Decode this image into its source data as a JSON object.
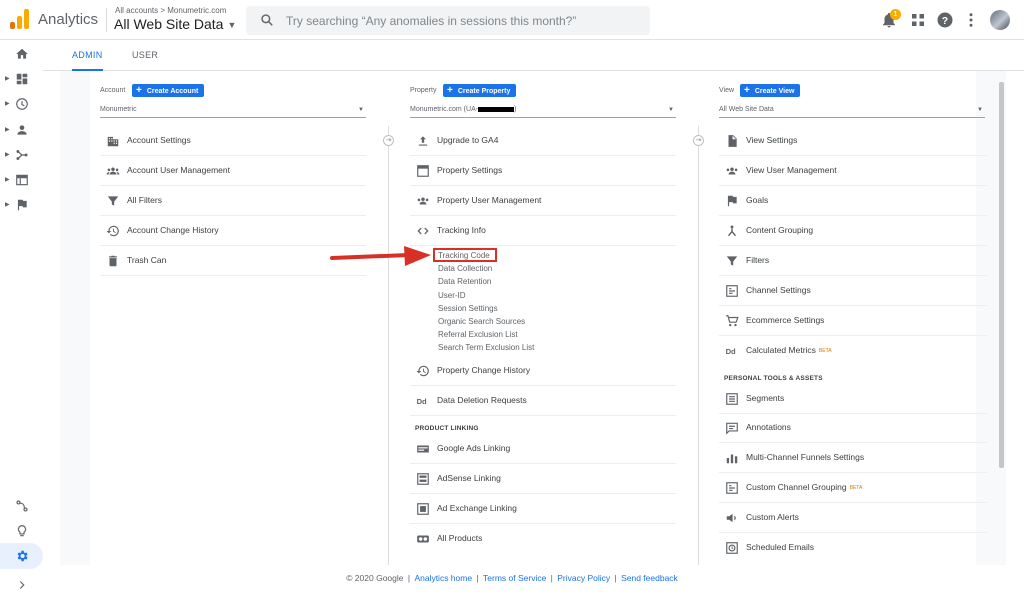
{
  "header": {
    "product": "Analytics",
    "breadcrumb": "All accounts > Monumetric.com",
    "view_name": "All Web Site Data",
    "search_placeholder": "Try searching “Any anomalies in sessions this month?”",
    "notification_count": "1"
  },
  "tabs": [
    {
      "label": "ADMIN",
      "active": true
    },
    {
      "label": "USER",
      "active": false
    }
  ],
  "account": {
    "label": "Account",
    "create_label": "Create Account",
    "selected": "Monumetric",
    "items": [
      {
        "label": "Account Settings",
        "icon": "building-icon"
      },
      {
        "label": "Account User Management",
        "icon": "people-icon"
      },
      {
        "label": "All Filters",
        "icon": "filter-icon"
      },
      {
        "label": "Account Change History",
        "icon": "history-icon"
      },
      {
        "label": "Trash Can",
        "icon": "trash-icon"
      }
    ]
  },
  "property": {
    "label": "Property",
    "create_label": "Create Property",
    "selected_prefix": "Monumetric.com (UA-",
    "selected_suffix": ")",
    "items": [
      {
        "label": "Upgrade to GA4",
        "icon": "upload-icon"
      },
      {
        "label": "Property Settings",
        "icon": "window-icon"
      },
      {
        "label": "Property User Management",
        "icon": "people-icon"
      },
      {
        "label": "Tracking Info",
        "icon": "code-icon"
      }
    ],
    "tracking_subitems": [
      "Tracking Code",
      "Data Collection",
      "Data Retention",
      "User-ID",
      "Session Settings",
      "Organic Search Sources",
      "Referral Exclusion List",
      "Search Term Exclusion List"
    ],
    "items_after": [
      {
        "label": "Property Change History",
        "icon": "history-icon"
      },
      {
        "label": "Data Deletion Requests",
        "icon": "dd-icon"
      }
    ],
    "product_linking_title": "PRODUCT LINKING",
    "linking_items": [
      {
        "label": "Google Ads Linking",
        "icon": "ads-icon"
      },
      {
        "label": "AdSense Linking",
        "icon": "adsense-icon"
      },
      {
        "label": "Ad Exchange Linking",
        "icon": "adexchange-icon"
      },
      {
        "label": "All Products",
        "icon": "products-icon"
      }
    ]
  },
  "view": {
    "label": "View",
    "create_label": "Create View",
    "selected": "All Web Site Data",
    "items": [
      {
        "label": "View Settings",
        "icon": "document-icon"
      },
      {
        "label": "View User Management",
        "icon": "people-icon"
      },
      {
        "label": "Goals",
        "icon": "flag-icon"
      },
      {
        "label": "Content Grouping",
        "icon": "grouping-icon"
      },
      {
        "label": "Filters",
        "icon": "filter-icon"
      },
      {
        "label": "Channel Settings",
        "icon": "channel-icon"
      },
      {
        "label": "Ecommerce Settings",
        "icon": "cart-icon"
      },
      {
        "label": "Calculated Metrics",
        "icon": "dd-icon",
        "badge": "BETA"
      }
    ],
    "personal_title": "PERSONAL TOOLS & ASSETS",
    "personal_items": [
      {
        "label": "Segments",
        "icon": "segments-icon"
      },
      {
        "label": "Annotations",
        "icon": "comment-icon"
      },
      {
        "label": "Multi-Channel Funnels Settings",
        "icon": "bars-icon"
      },
      {
        "label": "Custom Channel Grouping",
        "icon": "channel-icon",
        "badge": "BETA"
      },
      {
        "label": "Custom Alerts",
        "icon": "megaphone-icon"
      },
      {
        "label": "Scheduled Emails",
        "icon": "clock-icon"
      }
    ]
  },
  "footer": {
    "copyright": "© 2020 Google",
    "links": [
      "Analytics home",
      "Terms of Service",
      "Privacy Policy",
      "Send feedback"
    ]
  },
  "colors": {
    "accent": "#1a73e8",
    "highlight": "#d93025",
    "badge": "#f9ab00",
    "beta": "#e37400"
  }
}
